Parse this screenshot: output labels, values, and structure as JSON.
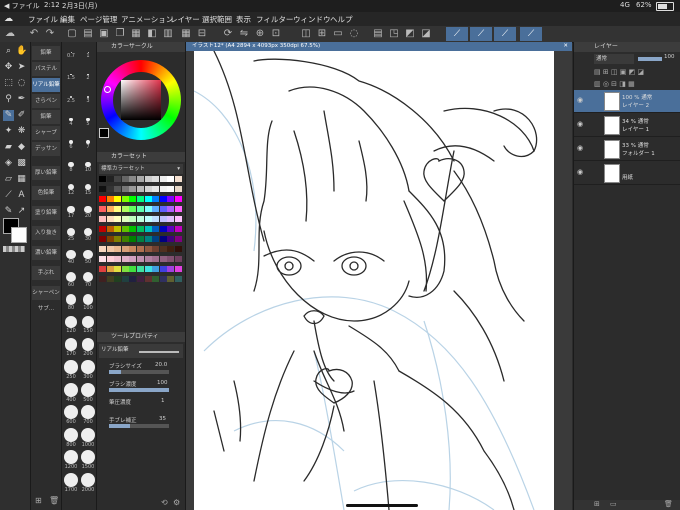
{
  "status": {
    "app_label": "◀ ファイル",
    "time": "2:12",
    "date": "2月3日(月)",
    "network": "4G",
    "battery": "62%"
  },
  "menu": [
    "ファイル",
    "編集",
    "ページ管理",
    "アニメーション",
    "レイヤー",
    "選択範囲",
    "表示",
    "フィルター",
    "ウィンドウ",
    "ヘルプ"
  ],
  "subtool": {
    "tabs": [
      "鉛筆",
      "パステル",
      "リアル鉛筆",
      "さらペン",
      "鉛筆",
      "シャープ",
      "デッサン",
      "厚い鉛筆",
      "色鉛筆",
      "塗り鉛筆",
      "入り抜き",
      "濃い鉛筆",
      "手ぶれ",
      "シャーペン"
    ],
    "footer": "サブ..."
  },
  "brush_sizes": [
    "0.7",
    "1",
    "1.5",
    "2",
    "2.5",
    "3",
    "4",
    "5",
    "6",
    "7",
    "8",
    "10",
    "12",
    "15",
    "17",
    "20",
    "25",
    "30",
    "40",
    "50",
    "60",
    "70",
    "80",
    "100",
    "120",
    "150",
    "170",
    "200",
    "250",
    "300",
    "400",
    "500",
    "600",
    "700",
    "800",
    "1000",
    "1200",
    "1500",
    "1700",
    "2000"
  ],
  "color_panel": {
    "title": "カラーサークル",
    "fg": "#000000",
    "bg": "#ffffff",
    "wheel_marker": "#e2334c"
  },
  "color_set": {
    "title": "カラーセット",
    "set_name": "標準カラーセット"
  },
  "tool_property": {
    "title": "ツールプロパティ",
    "subtool_name": "リアル鉛筆",
    "brush_size_label": "ブラシサイズ",
    "brush_size": "20.0",
    "density_label": "ブラシ濃度",
    "density": "100",
    "density_pct": 100,
    "pressure_label": "筆圧濃度",
    "pressure": "1",
    "stabilizer_label": "手ブレ補正",
    "stabilizer": "35"
  },
  "canvas": {
    "tab_title": "イラスト12* (A4 2894 x 4093px 350dpi 67.5%)"
  },
  "layers": {
    "title": "レイヤー",
    "blend_mode": "通常",
    "opacity": "100",
    "items": [
      {
        "opacity_mode": "100 %  通常",
        "name": "レイヤー 2",
        "selected": true
      },
      {
        "opacity_mode": "34 %  通常",
        "name": "レイヤー 1",
        "selected": false
      },
      {
        "opacity_mode": "33 %  通常",
        "name": "フォルダー 1",
        "selected": false
      },
      {
        "opacity_mode": "",
        "name": "用紙",
        "selected": false
      }
    ]
  },
  "icons": [
    "cloud-icon",
    "undo-icon",
    "redo-icon",
    "move-icon",
    "zoom-icon",
    "pen-icon",
    "pencil-icon",
    "brush-icon",
    "eraser-icon",
    "fill-icon",
    "gradient-icon",
    "text-icon",
    "lasso-icon",
    "eye-icon",
    "folder-icon",
    "trash-icon"
  ]
}
